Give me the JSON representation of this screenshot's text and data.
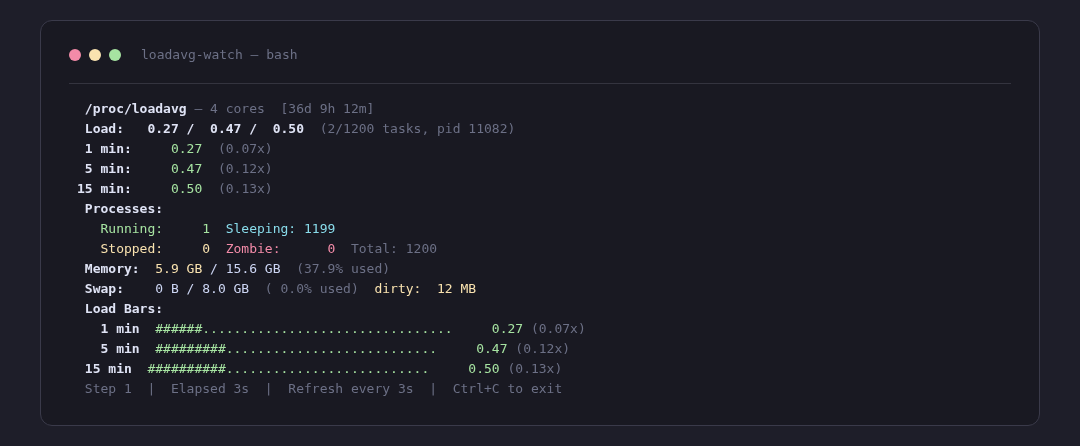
{
  "window": {
    "title": "loadavg-watch — bash",
    "controls": [
      {
        "color": "#f38ba8"
      },
      {
        "color": "#f9e2af"
      },
      {
        "color": "#a6e3a1"
      }
    ]
  },
  "lines": [
    {
      "segments": [
        {
          "kind": "bold",
          "text": " /proc/loadavg"
        },
        {
          "kind": "dim",
          "text": " — 4 cores  [36d 9h 12m]"
        }
      ]
    },
    {
      "segments": [
        {
          "kind": "bold",
          "text": " Load:   0.27 /  0.47 /  0.50"
        },
        {
          "kind": "dim",
          "text": "  (2/1200 tasks, pid 11082)"
        }
      ]
    },
    {
      "segments": [
        {
          "kind": "bold",
          "text": " 1 min:"
        },
        {
          "kind": "green",
          "text": "     0.27"
        },
        {
          "kind": "dim",
          "text": "  (0.07x)"
        }
      ]
    },
    {
      "segments": [
        {
          "kind": "bold",
          "text": " 5 min:"
        },
        {
          "kind": "green",
          "text": "     0.47"
        },
        {
          "kind": "dim",
          "text": "  (0.12x)"
        }
      ]
    },
    {
      "segments": [
        {
          "kind": "bold",
          "text": "15 min:"
        },
        {
          "kind": "green",
          "text": "     0.50"
        },
        {
          "kind": "dim",
          "text": "  (0.13x)"
        }
      ]
    },
    {
      "segments": [
        {
          "kind": "bold",
          "text": " Processes:"
        }
      ]
    },
    {
      "segments": [
        {
          "kind": "green",
          "text": "   Running:     1"
        },
        {
          "kind": "cyan",
          "text": "  Sleeping: 1199"
        }
      ]
    },
    {
      "segments": [
        {
          "kind": "yellow",
          "text": "   Stopped:     0"
        },
        {
          "kind": "red",
          "text": "  Zombie:      0"
        },
        {
          "kind": "dim",
          "text": "  Total: 1200"
        }
      ]
    },
    {
      "segments": [
        {
          "kind": "bold",
          "text": " Memory:"
        },
        {
          "kind": "yellow",
          "text": "  5.9 GB"
        },
        {
          "kind": "plain",
          "text": " / 15.6 GB"
        },
        {
          "kind": "dim",
          "text": "  (37.9% used)"
        }
      ]
    },
    {
      "segments": [
        {
          "kind": "bold",
          "text": " Swap:"
        },
        {
          "kind": "plain",
          "text": "    0 B / 8.0 GB"
        },
        {
          "kind": "dim",
          "text": "  ( 0.0% used)"
        },
        {
          "kind": "yellow",
          "text": "  dirty:  12 MB"
        }
      ]
    },
    {
      "segments": [
        {
          "kind": "bold",
          "text": " Load Bars:"
        }
      ]
    },
    {
      "segments": [
        {
          "kind": "bold",
          "text": "   1 min"
        },
        {
          "kind": "green",
          "text": "  ######................................     0.27"
        },
        {
          "kind": "dim",
          "text": " (0.07x)"
        }
      ]
    },
    {
      "segments": [
        {
          "kind": "bold",
          "text": "   5 min"
        },
        {
          "kind": "green",
          "text": "  #########...........................     0.47"
        },
        {
          "kind": "dim",
          "text": " (0.12x)"
        }
      ]
    },
    {
      "segments": [
        {
          "kind": "bold",
          "text": " 15 min"
        },
        {
          "kind": "green",
          "text": "  ##########..........................     0.50"
        },
        {
          "kind": "dim",
          "text": " (0.13x)"
        }
      ]
    },
    {
      "segments": [
        {
          "kind": "dim",
          "text": " Step 1  |  Elapsed 3s  |  Refresh every 3s  |  Ctrl+C to exit"
        }
      ]
    }
  ]
}
